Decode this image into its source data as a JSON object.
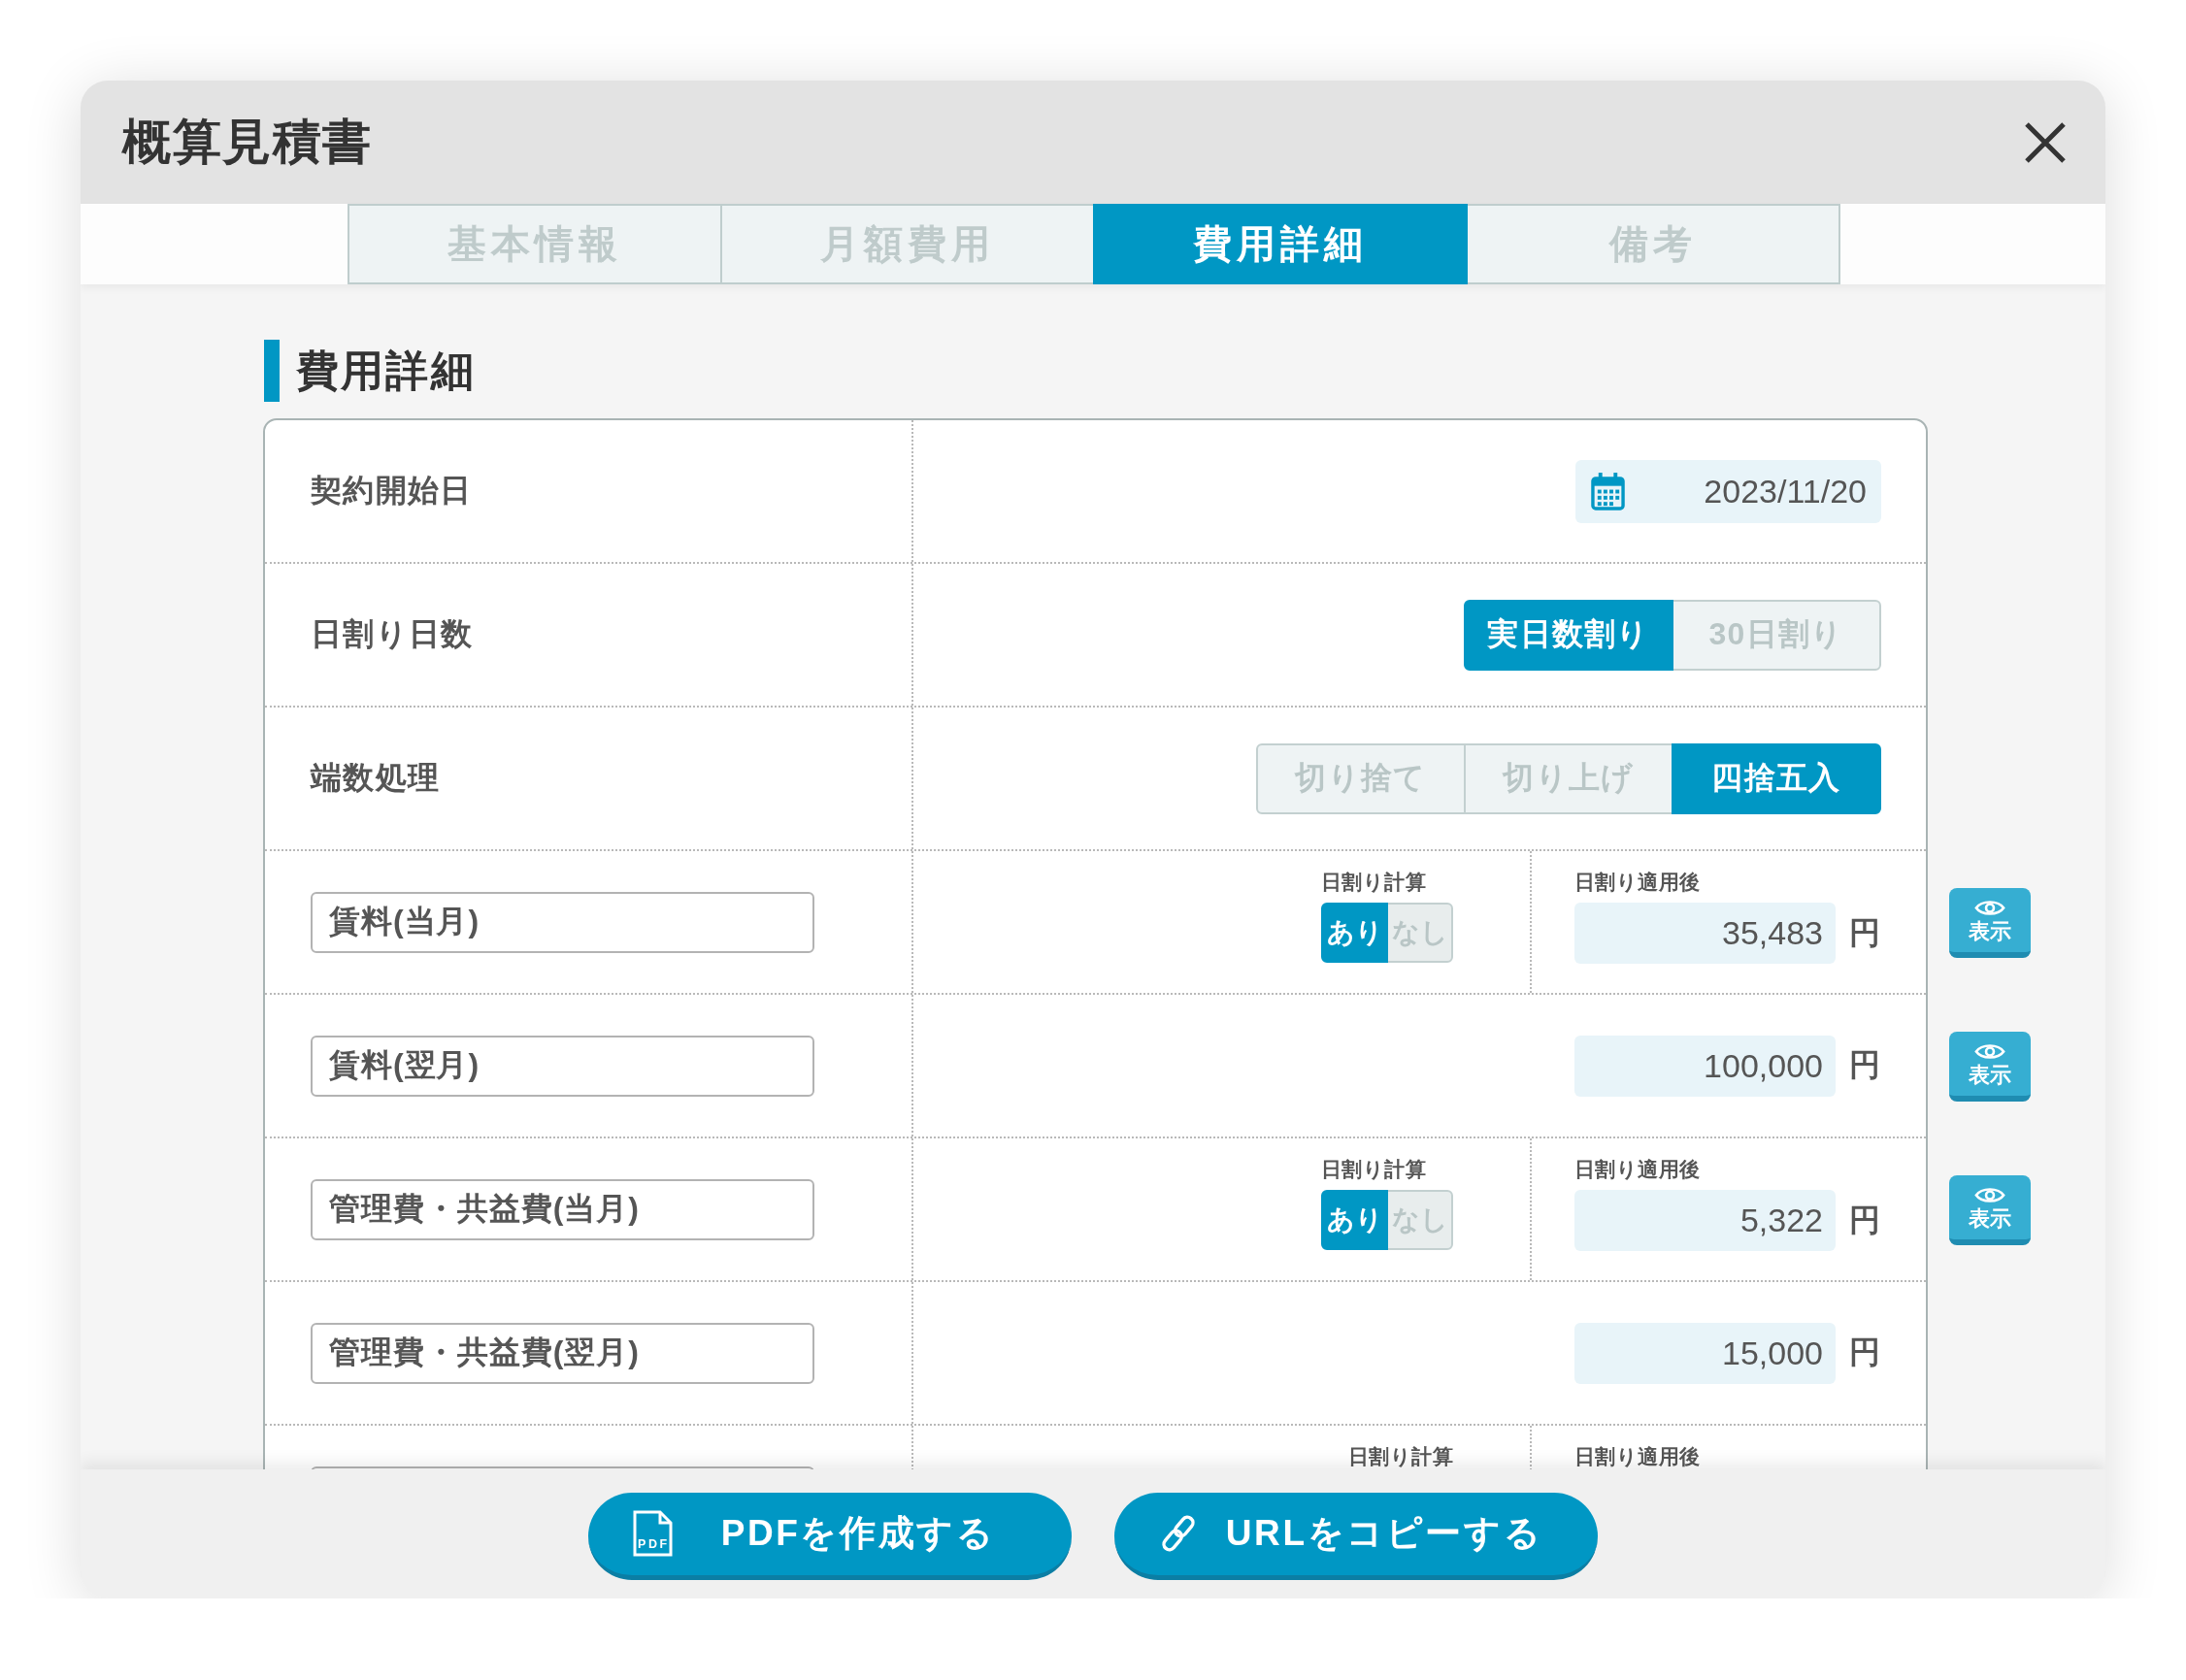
{
  "window": {
    "title": "概算見積書"
  },
  "tabs": [
    {
      "label": "基本情報",
      "selected": false
    },
    {
      "label": "月額費用",
      "selected": false
    },
    {
      "label": "費用詳細",
      "selected": true
    },
    {
      "label": "備考",
      "selected": false
    }
  ],
  "section": {
    "title": "費用詳細"
  },
  "settings": [
    {
      "kind": "date",
      "label": "契約開始日",
      "value": "2023/11/20"
    },
    {
      "kind": "segmented",
      "label": "日割り日数",
      "options": [
        {
          "label": "実日数割り",
          "selected": true
        },
        {
          "label": "30日割り",
          "selected": false
        }
      ]
    },
    {
      "kind": "segmented",
      "label": "端数処理",
      "options": [
        {
          "label": "切り捨て",
          "selected": false
        },
        {
          "label": "切り上げ",
          "selected": false
        },
        {
          "label": "四捨五入",
          "selected": true
        }
      ]
    }
  ],
  "cost_items": [
    {
      "name": "賃料(当月)",
      "prorate": {
        "label": "日割り計算",
        "options": [
          {
            "label": "あり",
            "selected": true
          },
          {
            "label": "なし",
            "selected": false
          }
        ]
      },
      "amount_label": "日割り適用後",
      "amount": "35,483",
      "unit": "円",
      "view_button": "表示"
    },
    {
      "name": "賃料(翌月)",
      "amount": "100,000",
      "unit": "円",
      "view_button": "表示"
    },
    {
      "name": "管理費・共益費(当月)",
      "prorate": {
        "label": "日割り計算",
        "options": [
          {
            "label": "あり",
            "selected": true
          },
          {
            "label": "なし",
            "selected": false
          }
        ]
      },
      "amount_label": "日割り適用後",
      "amount": "5,322",
      "unit": "円",
      "view_button": "表示"
    },
    {
      "name": "管理費・共益費(翌月)",
      "amount": "15,000",
      "unit": "円"
    },
    {
      "prorate": {
        "label": "日割り計算"
      },
      "amount_label": "日割り適用後"
    }
  ],
  "footer_buttons": [
    {
      "kind": "pdf",
      "label": "PDFを作成する",
      "icon_text": "PDF"
    },
    {
      "kind": "link",
      "label": "URLをコピーする"
    }
  ]
}
